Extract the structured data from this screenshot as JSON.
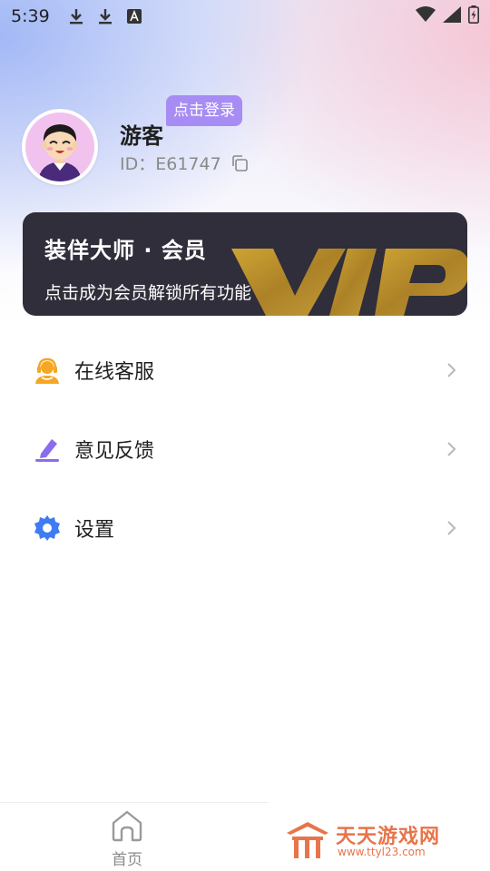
{
  "status_bar": {
    "time": "5:39",
    "icons_left": [
      "download-icon",
      "download-icon",
      "text-a-icon"
    ],
    "icons_right": [
      "wifi-icon",
      "signal-icon",
      "battery-charging-icon"
    ]
  },
  "profile": {
    "login_badge": "点击登录",
    "username": "游客",
    "user_id": "ID：E61747",
    "avatar_icon": "cartoon-avatar-icon",
    "copy_icon": "copy-icon"
  },
  "vip": {
    "title": "装佯大师 · 会员",
    "subtitle": "点击成为会员解锁所有功能",
    "art_text": "VIP",
    "colors": {
      "card": "#2f2e3a",
      "gold": "#c4982a"
    }
  },
  "menu": {
    "items": [
      {
        "label": "在线客服",
        "icon": "customer-service-icon",
        "color": "#f5a623"
      },
      {
        "label": "意见反馈",
        "icon": "edit-pen-icon",
        "color": "#8b6cf0"
      },
      {
        "label": "设置",
        "icon": "gear-icon",
        "color": "#3f7bf2"
      }
    ]
  },
  "tabbar": {
    "home_label": "首页",
    "home_icon": "home-icon"
  },
  "watermark": {
    "text": "天天游戏网",
    "url": "www.ttyl23.com"
  },
  "colors": {
    "accent": "#a78cf4",
    "brand_watermark": "#e8744a"
  }
}
